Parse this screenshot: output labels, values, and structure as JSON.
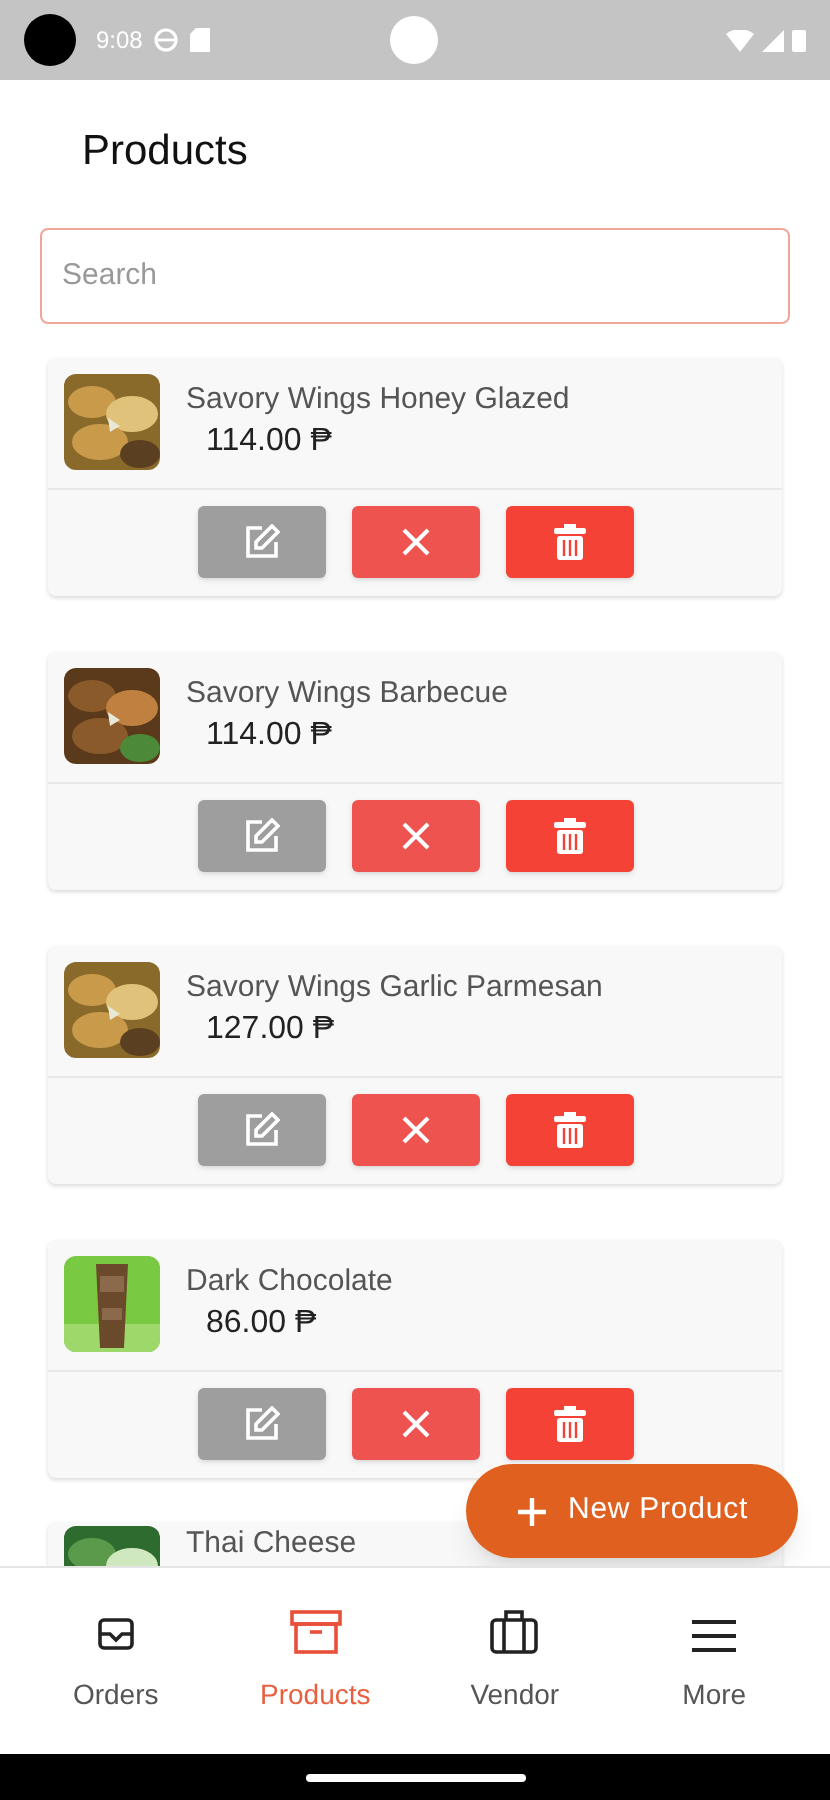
{
  "status_bar": {
    "time": "9:08"
  },
  "title": "Products",
  "search": {
    "placeholder": "Search"
  },
  "products": [
    {
      "name": "Savory Wings Honey Glazed",
      "price": "114.00 ₱"
    },
    {
      "name": "Savory Wings Barbecue",
      "price": "114.00 ₱"
    },
    {
      "name": "Savory Wings Garlic Parmesan",
      "price": "127.00 ₱"
    },
    {
      "name": "Dark Chocolate",
      "price": "86.00 ₱"
    },
    {
      "name": "Thai Cheese"
    }
  ],
  "fab": {
    "label": "New Product"
  },
  "nav": [
    {
      "label": "Orders",
      "selected": false
    },
    {
      "label": "Products",
      "selected": true
    },
    {
      "label": "Vendor",
      "selected": false
    },
    {
      "label": "More",
      "selected": false
    }
  ]
}
